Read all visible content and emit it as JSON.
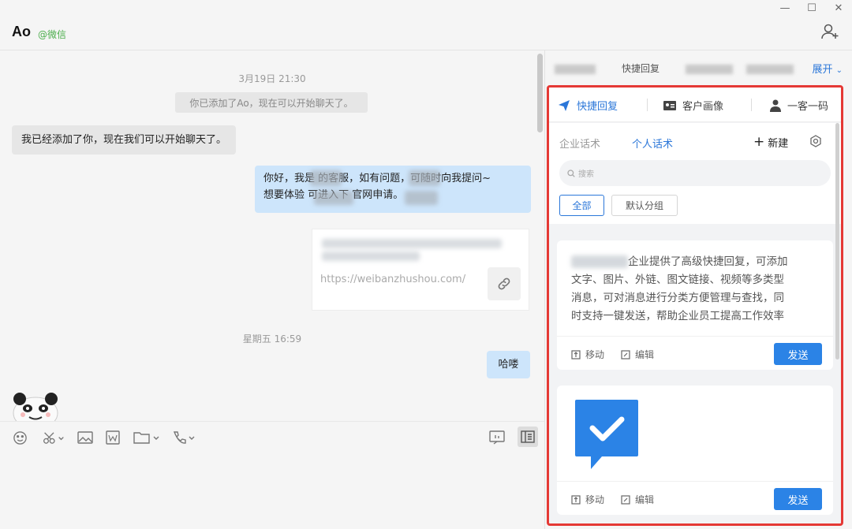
{
  "window": {
    "minimize_glyph": "—",
    "maximize_glyph": "☐",
    "close_glyph": "✕"
  },
  "header": {
    "contact_name": "Ao",
    "contact_tag": "@微信",
    "add_icon": "add-user-icon"
  },
  "chat": {
    "time1": "3月19日 21:30",
    "system_msg": "你已添加了Ao，现在可以开始聊天了。",
    "msg_in": "我已经添加了你，现在我们可以开始聊天了。",
    "msg_out_line1": "你好，我是 的客服，如有问题，可随时向我提问~",
    "msg_out_line2": "想要体验 可进入下 官网申请。",
    "link_url": "https://weibanzhushou.com/",
    "time2": "星期五 16:59",
    "msg_small": "哈喽"
  },
  "toolbar": {
    "icons": [
      "emoji-icon",
      "scissors-icon",
      "image-icon",
      "word-icon",
      "folder-icon",
      "phone-icon",
      "chat-record-icon",
      "sidebar-panel-icon"
    ]
  },
  "right_top": {
    "label": "快捷回复",
    "expand": "展开"
  },
  "panel": {
    "tabs": [
      {
        "label": "快捷回复",
        "icon": "send-plane-icon"
      },
      {
        "label": "客户画像",
        "icon": "id-card-icon"
      },
      {
        "label": "一客一码",
        "icon": "person-icon"
      }
    ],
    "sub_tabs": [
      "企业话术",
      "个人话术"
    ],
    "new_label": "新建",
    "search_placeholder": "搜索",
    "chips": [
      "全部",
      "默认分组"
    ],
    "cards": [
      {
        "line1": "企业提供了高级快捷回复，可添加",
        "line2": "文字、图片、外链、图文链接、视频等多类型",
        "line3": "消息，可对消息进行分类方便管理与查找，同",
        "line4": "时支持一键发送，帮助企业员工提高工作效率",
        "move": "移动",
        "edit": "编辑",
        "send": "发送"
      },
      {
        "move": "移动",
        "edit": "编辑",
        "send": "发送"
      }
    ]
  },
  "colors": {
    "accent": "#2b77d9",
    "highlight_border": "#e53935",
    "bubble_out": "#cde5fb"
  }
}
